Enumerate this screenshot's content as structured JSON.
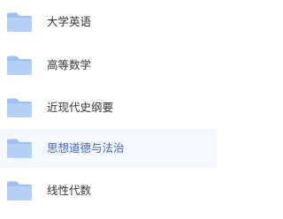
{
  "folders": [
    {
      "label": "大学英语",
      "icon": "folder-icon",
      "selected": false
    },
    {
      "label": "高等数学",
      "icon": "folder-icon",
      "selected": false
    },
    {
      "label": "近现代史纲要",
      "icon": "folder-icon",
      "selected": false
    },
    {
      "label": "思想道德与法治",
      "icon": "folder-icon",
      "selected": true
    },
    {
      "label": "线性代数",
      "icon": "folder-icon",
      "selected": false
    }
  ],
  "colors": {
    "folder_back": "#9ebff1",
    "folder_front": "#b5d0f6",
    "selected_background": "#f4f7fd",
    "selected_text": "#3a66c6",
    "text": "#333333"
  }
}
